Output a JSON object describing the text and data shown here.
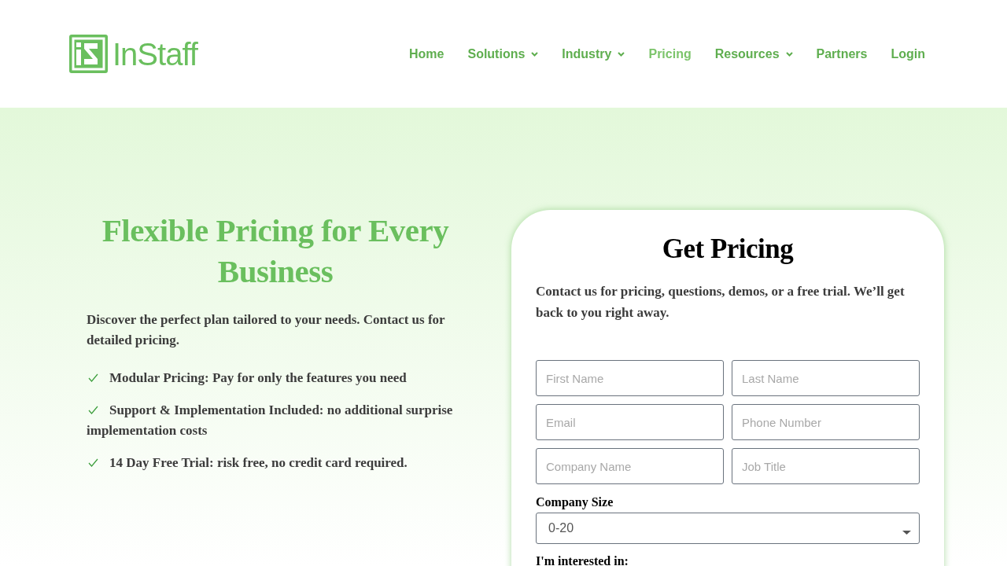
{
  "logo": {
    "text": "InStaff"
  },
  "nav": [
    {
      "label": "Home",
      "dropdown": false,
      "selected": false
    },
    {
      "label": "Solutions",
      "dropdown": true,
      "selected": false
    },
    {
      "label": "Industry",
      "dropdown": true,
      "selected": false
    },
    {
      "label": "Pricing",
      "dropdown": false,
      "selected": true
    },
    {
      "label": "Resources",
      "dropdown": true,
      "selected": false
    },
    {
      "label": "Partners",
      "dropdown": false,
      "selected": false
    },
    {
      "label": "Login",
      "dropdown": false,
      "selected": false
    }
  ],
  "hero": {
    "title": "Flexible Pricing for Every Business",
    "intro": "Discover the perfect plan tailored to your needs. Contact us for detailed pricing.",
    "features": [
      "Modular Pricing: Pay for only the features you need",
      "Support & Implementation Included: no additional surprise implementation costs",
      "14 Day Free Trial: risk free, no credit card required."
    ]
  },
  "form": {
    "title": "Get Pricing",
    "intro": "Contact us for pricing, questions, demos, or a free trial. We’ll get back to you right away.",
    "fields": [
      {
        "placeholder": "First Name"
      },
      {
        "placeholder": "Last Name"
      },
      {
        "placeholder": "Email"
      },
      {
        "placeholder": "Phone Number"
      },
      {
        "placeholder": "Company Name"
      },
      {
        "placeholder": "Job Title"
      }
    ],
    "company_size": {
      "label": "Company Size",
      "value": "0-20"
    },
    "interest": {
      "label": "I'm interested in:"
    }
  }
}
